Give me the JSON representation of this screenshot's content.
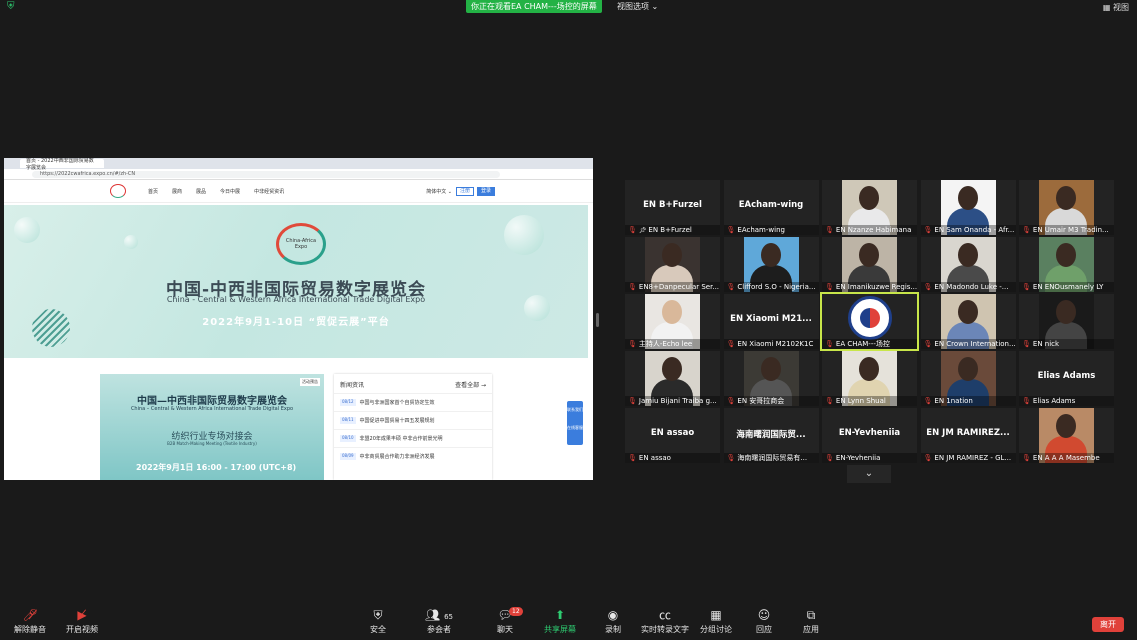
{
  "top": {
    "sharing_banner": "你正在观看EA CHAM---场控的屏幕",
    "view_options": "视图选项 ⌄",
    "view_button": "视图"
  },
  "shared_screen": {
    "browser": {
      "tab_title": "首页 - 2022中西非国际贸易数字展览会",
      "url": "https://2022cwafrica.expo.cn/#/zh-CN"
    },
    "site_nav": [
      "首页",
      "展商",
      "展品",
      "今日中展",
      "中非经贸资讯"
    ],
    "lang": "简体中文 ⌄",
    "login": "注册",
    "register": "登录",
    "banner": {
      "logo_text": "China-Africa Expo",
      "title": "中国-中西非国际贸易数字展览会",
      "subtitle": "China - Central & Western Africa International Trade Digital Expo",
      "date": "2022年9月1-10日  “贸促云展”平台"
    },
    "card1": {
      "badge": "活动预告",
      "title": "中国—中西非国际贸易数字展览会",
      "subtitle": "China – Central & Western Africa International Trade Digital Expo",
      "event": "纺织行业专场对接会",
      "event_en": "B2B Match-Making Meeting (Textile Industry)",
      "date": "2022年9月1日     16:00 - 17:00 (UTC+8)"
    },
    "card2": {
      "heading": "新闻资讯",
      "more": "查看全部 →",
      "news": [
        {
          "date": "08/12",
          "text": "中国与非洲国家首个自贸协定生效"
        },
        {
          "date": "08/11",
          "text": "中国促进中国贸易十四五发展规划"
        },
        {
          "date": "08/10",
          "text": "非盟20年成果丰硕  中非合作前景光明"
        },
        {
          "date": "08/09",
          "text": "中非商贸展合作助力非洲经济发展"
        }
      ]
    },
    "side_buttons": [
      "联系我们",
      "在线客服"
    ]
  },
  "gallery": [
    {
      "big": "EN B+Furzel",
      "label": "EN B+Furzel",
      "pin": true
    },
    {
      "big": "EAcham-wing",
      "label": "EAcham-wing"
    },
    {
      "label": "EN Nzanze Habimana",
      "video": true,
      "bg": "#cfc8b8",
      "shirt": "#e9e9ea"
    },
    {
      "label": "EN Sam Onanda - Afr...",
      "video": true,
      "bg": "#f4f4f4",
      "shirt": "#2c4f86"
    },
    {
      "label": "EN Umair M3 Tradin...",
      "video": true,
      "bg": "#9c6b3c",
      "shirt": "#d9d9d9"
    },
    {
      "label": "EN8+Danpecular Ser...",
      "video": true,
      "bg": "#3a3330",
      "shirt": "#d8c9bb"
    },
    {
      "label": "Clifford S.O - Nigeria...",
      "video": true,
      "bg": "#5fa8d9",
      "shirt": "#1d1d1d"
    },
    {
      "label": "EN Imanikuzwe Regis...",
      "video": true,
      "bg": "#bdb4a6",
      "shirt": "#3a3a3a"
    },
    {
      "label": "EN Madondo Luke -...",
      "video": true,
      "bg": "#d9d6cf",
      "shirt": "#4a4a4a"
    },
    {
      "label": "EN ENOusmanely LY",
      "video": true,
      "bg": "#5a8060",
      "shirt": "#6fa06a"
    },
    {
      "label": "主持人-Echo lee",
      "video": true,
      "bg": "#e9e6e2",
      "shirt": "#f2f2f2",
      "light": true
    },
    {
      "big": "EN Xiaomi M21...",
      "label": "EN Xiaomi M2102K1C"
    },
    {
      "label": "EA CHAM---场控",
      "logo": true,
      "active": true
    },
    {
      "label": "EN Crown Internation...",
      "video": true,
      "bg": "#cfc4b0",
      "shirt": "#6b86b8"
    },
    {
      "label": "EN nick",
      "video": true,
      "bg": "#1a1a1a",
      "shirt": "#444"
    },
    {
      "label": "Jamiu Bijani Traiba g...",
      "video": true,
      "bg": "#d8d4cc",
      "shirt": "#2a2a2a"
    },
    {
      "label": "EN 安哥拉商会",
      "video": true,
      "bg": "#3c3a35",
      "shirt": "#555"
    },
    {
      "label": "EN Lynn Shual",
      "video": true,
      "bg": "#e5e2da",
      "shirt": "#e0d4b0"
    },
    {
      "label": "EN 1nation",
      "video": true,
      "bg": "#6a4a3a",
      "shirt": "#1e3e6a"
    },
    {
      "big": "Elias Adams",
      "label": "Elias Adams"
    },
    {
      "big": "EN assao",
      "label": "EN assao"
    },
    {
      "big": "海南曙润国际贸...",
      "label": "海南曙润国际贸易有..."
    },
    {
      "big": "EN-Yevheniia",
      "label": "EN-Yevheniia"
    },
    {
      "big": "EN JM RAMIREZ...",
      "label": "EN JM RAMIREZ - GL..."
    },
    {
      "label": "EN A A A Masembe",
      "video": true,
      "bg": "#b98a66",
      "shirt": "#d14a30"
    }
  ],
  "more_button": "⌄",
  "toolbar": {
    "mute": "解除静音",
    "video": "开启视频",
    "security": "安全",
    "participants": "参会者",
    "participants_count": "65",
    "chat": "聊天",
    "chat_badge": "12",
    "share": "共享屏幕",
    "record": "录制",
    "cc": "实时转录文字",
    "breakout": "分组讨论",
    "reactions": "回应",
    "apps": "应用",
    "leave": "离开"
  },
  "colors": {
    "accent_green": "#23b245",
    "leave_red": "#e0413a",
    "active_speaker": "#c8e64a"
  }
}
